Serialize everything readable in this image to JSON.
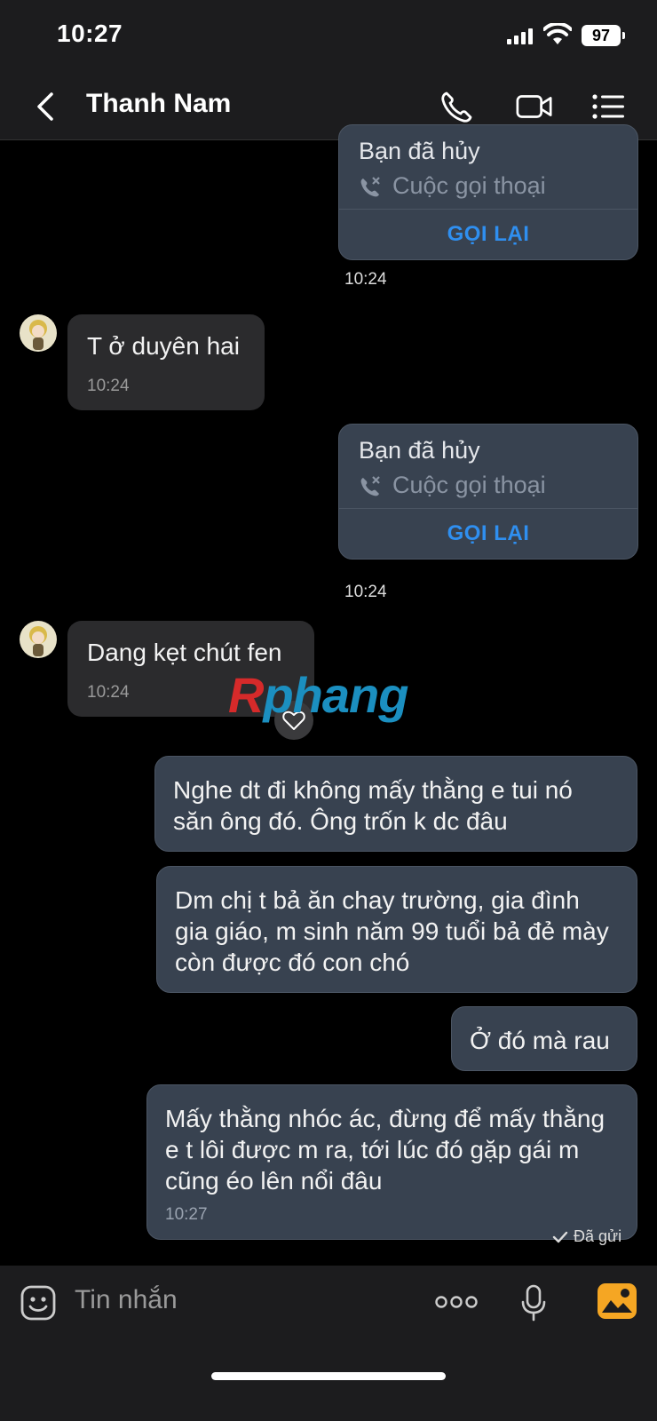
{
  "status_bar": {
    "time": "10:27",
    "battery": "97"
  },
  "header": {
    "title": "Thanh Nam"
  },
  "messages": {
    "call1": {
      "title": "Bạn đã hủy",
      "subtitle": "Cuộc gọi thoại",
      "action": "GỌI LẠI",
      "time": "10:24"
    },
    "in1": {
      "text": "T ở duyên hai",
      "time": "10:24"
    },
    "call2": {
      "title": "Bạn đã hủy",
      "subtitle": "Cuộc gọi thoại",
      "action": "GỌI LẠI",
      "time": "10:24"
    },
    "in2": {
      "text": "Dang kẹt chút fen",
      "time": "10:24"
    },
    "out1": {
      "text": "Nghe dt đi không mấy thằng e tui nó săn ông đó. Ông trốn k dc đâu"
    },
    "out2": {
      "text": "Dm chị t bả ăn chay trường, gia đình gia giáo, m sinh năm 99 tuổi bả đẻ mày còn được đó con chó"
    },
    "out3": {
      "text": "Ở đó mà rau"
    },
    "out4": {
      "text": "Mấy thằng nhóc ác, đừng để mấy thằng e t lôi được m ra, tới lúc đó gặp gái m cũng éo lên nổi đâu",
      "time": "10:27"
    },
    "status": "Đã gửi"
  },
  "watermark": {
    "part1": "R",
    "part2": "phang"
  },
  "input": {
    "placeholder": "Tin nhắn"
  },
  "colors": {
    "accent": "#2f8ff0",
    "bubble_out": "#384250",
    "bubble_in": "#2b2b2d"
  }
}
